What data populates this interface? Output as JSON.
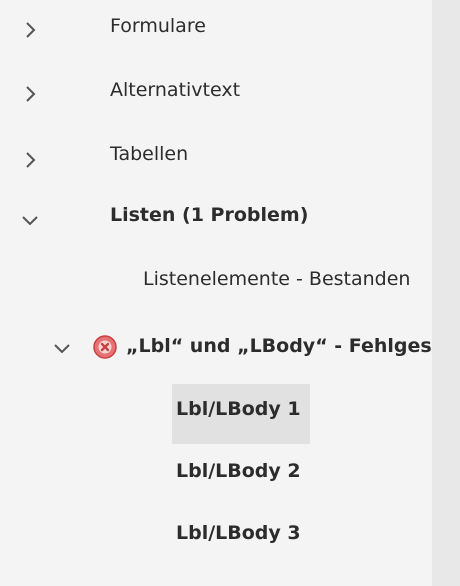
{
  "tree": {
    "items": [
      {
        "label": "Formulare",
        "state": "collapsed"
      },
      {
        "label": "Alternativtext",
        "state": "collapsed"
      },
      {
        "label": "Tabellen",
        "state": "collapsed"
      },
      {
        "label": "Listen (1 Problem)",
        "state": "expanded"
      },
      {
        "label": "Listenelemente - Bestanden"
      },
      {
        "label": "„Lbl“ und „LBody“ - Fehlgeschlagen",
        "state": "expanded",
        "status": "failed"
      },
      {
        "label": "Lbl/LBody 1",
        "selected": true
      },
      {
        "label": "Lbl/LBody 2"
      },
      {
        "label": "Lbl/LBody 3"
      }
    ]
  },
  "colors": {
    "panel_bg": "#f4f4f4",
    "rail_bg": "#e8e8e8",
    "selection_bg": "#e1e1e1",
    "text": "#2c2c2c",
    "error_icon": "#d9534f"
  },
  "icons": {
    "collapsed": "chevron-right-icon",
    "expanded": "chevron-down-icon",
    "failed": "error-x-icon"
  }
}
